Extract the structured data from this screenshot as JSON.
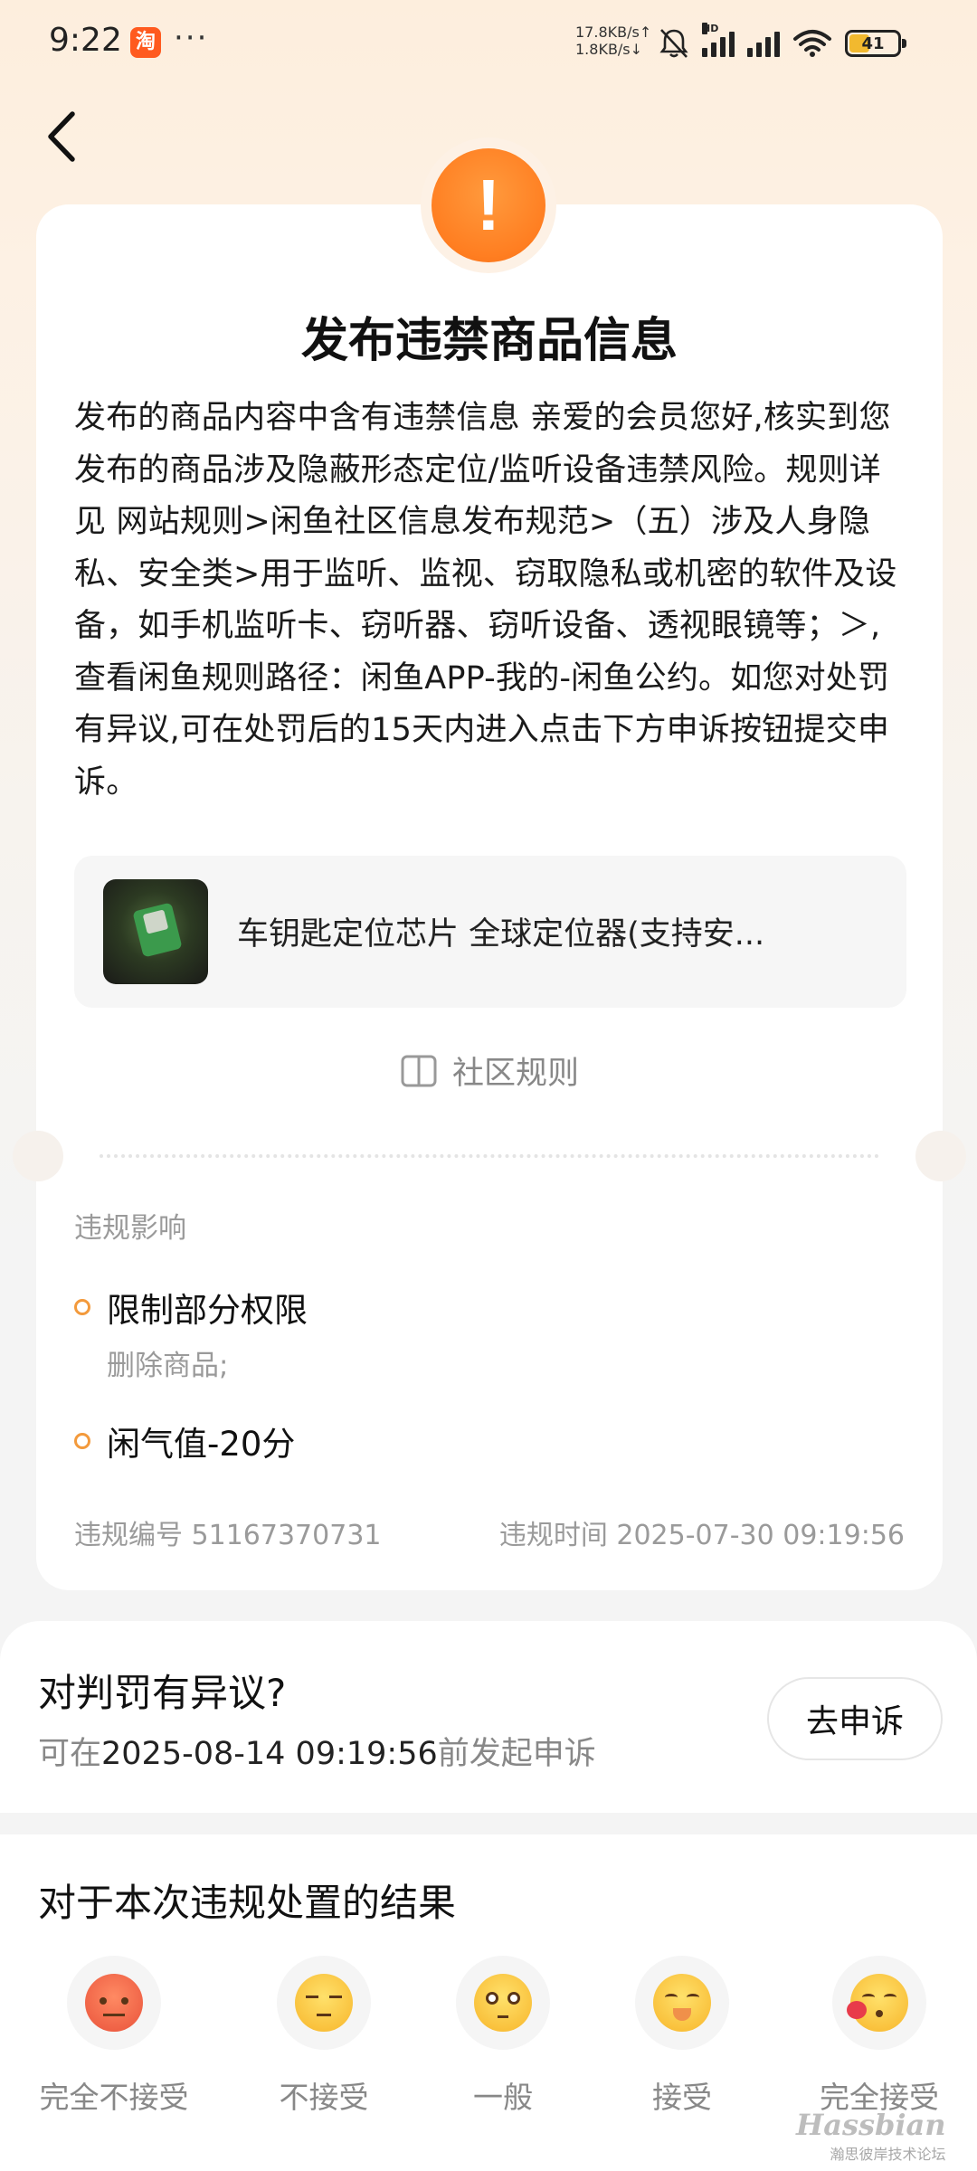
{
  "status_bar": {
    "time": "9:22",
    "app_badge": "淘",
    "more": "···",
    "net_up": "17.8KB/s↑",
    "net_down": "1.8KB/s↓",
    "hd": "HD",
    "battery": "41",
    "battery_color": "#f2b92f"
  },
  "header": {
    "back_icon": "chevron-left-icon"
  },
  "violation": {
    "alert_icon": "exclamation-icon",
    "alert_color": "#ff7e21",
    "title": "发布违禁商品信息",
    "description": "发布的商品内容中含有违禁信息 亲爱的会员您好,核实到您发布的商品涉及隐蔽形态定位/监听设备违禁风险。规则详见 网站规则>闲鱼社区信息发布规范>（五）涉及人身隐私、安全类>用于监听、监视、窃取隐私或机密的软件及设备，如手机监听卡、窃听器、窃听设备、透视眼镜等；＞,查看闲鱼规则路径：闲鱼APP-我的-闲鱼公约。如您对处罚有异议,可在处罚后的15天内进入点击下方申诉按钮提交申诉。",
    "product_title": "车钥匙定位芯片 全球定位器(支持安...",
    "rules_link": "社区规则",
    "impact_label": "违规影响",
    "impacts": [
      {
        "title": "限制部分权限",
        "detail": "删除商品;"
      },
      {
        "title": "闲气值-20分"
      }
    ],
    "violation_no": "违规编号 51167370731",
    "violation_time": "违规时间 2025-07-30 09:19:56",
    "bullet_color": "#f39a3c"
  },
  "appeal": {
    "title": "对判罚有异议?",
    "prefix": "可在",
    "deadline": "2025-08-14 09:19:56",
    "suffix": "前发起申诉",
    "button": "去申诉"
  },
  "feedback": {
    "title": "对于本次违规处置的结果",
    "options": [
      {
        "label": "完全不接受",
        "icon": "angry-face-icon"
      },
      {
        "label": "不接受",
        "icon": "unamused-face-icon"
      },
      {
        "label": "一般",
        "icon": "neutral-face-icon"
      },
      {
        "label": "接受",
        "icon": "smiling-face-icon"
      },
      {
        "label": "完全接受",
        "icon": "kissing-face-icon"
      }
    ]
  },
  "watermark": {
    "main": "Hassbian",
    "sub": "瀚思彼岸技术论坛"
  }
}
